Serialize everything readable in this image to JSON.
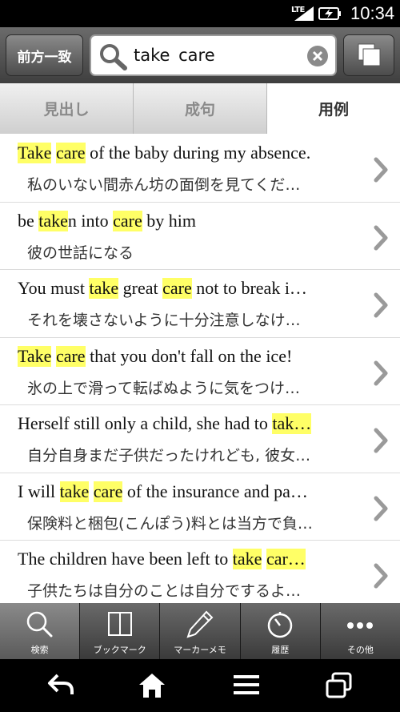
{
  "status": {
    "network": "LTE",
    "time": "10:34"
  },
  "search": {
    "mode_label": "前方一致",
    "query": "take  care"
  },
  "tabs": [
    {
      "label": "見出し",
      "active": false
    },
    {
      "label": "成句",
      "active": false
    },
    {
      "label": "用例",
      "active": true
    }
  ],
  "results": [
    {
      "en": [
        [
          "Take",
          true
        ],
        [
          " ",
          false
        ],
        [
          "care",
          true
        ],
        [
          " of the baby during my absence.",
          false
        ]
      ],
      "ja": "私のいない間赤ん坊の面倒を見てくだ…"
    },
    {
      "en": [
        [
          "be ",
          false
        ],
        [
          "take",
          true
        ],
        [
          "n into ",
          false
        ],
        [
          "care",
          true
        ],
        [
          " by him",
          false
        ]
      ],
      "ja": "彼の世話になる"
    },
    {
      "en": [
        [
          "You must ",
          false
        ],
        [
          "take",
          true
        ],
        [
          " great ",
          false
        ],
        [
          "care",
          true
        ],
        [
          " not to break i…",
          false
        ]
      ],
      "ja": "それを壊さないように十分注意しなけ…"
    },
    {
      "en": [
        [
          "Take",
          true
        ],
        [
          " ",
          false
        ],
        [
          "care",
          true
        ],
        [
          " that you don't fall on the ice!",
          false
        ]
      ],
      "ja": "氷の上で滑って転ばぬように気をつけ…"
    },
    {
      "en": [
        [
          "Herself still only a child, she had to ",
          false
        ],
        [
          "tak…",
          true
        ]
      ],
      "ja": "自分自身まだ子供だったけれども, 彼女…"
    },
    {
      "en": [
        [
          "I will ",
          false
        ],
        [
          "take",
          true
        ],
        [
          " ",
          false
        ],
        [
          "care",
          true
        ],
        [
          " of the insurance and pa…",
          false
        ]
      ],
      "ja": "保険料と梱包(こんぽう)料とは当方で負…"
    },
    {
      "en": [
        [
          "The children have been left to ",
          false
        ],
        [
          "take",
          true
        ],
        [
          " ",
          false
        ],
        [
          "car…",
          true
        ]
      ],
      "ja": "子供たちは自分のことは自分でするよ…"
    }
  ],
  "toolbar": [
    {
      "label": "検索",
      "icon": "search-icon",
      "active": true
    },
    {
      "label": "ブックマーク",
      "icon": "book-icon",
      "active": false
    },
    {
      "label": "マーカーメモ",
      "icon": "pen-icon",
      "active": false
    },
    {
      "label": "履歴",
      "icon": "clock-icon",
      "active": false
    },
    {
      "label": "その他",
      "icon": "more-icon",
      "active": false
    }
  ],
  "colors": {
    "highlight": "#ffff66",
    "header": "#4f4f4f"
  }
}
